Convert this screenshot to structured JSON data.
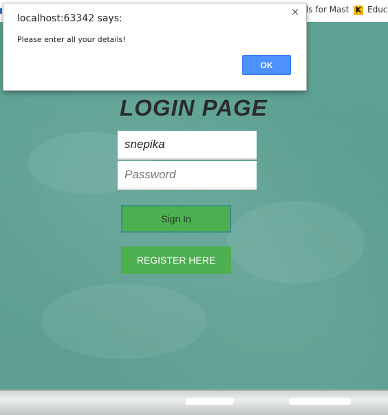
{
  "bookmarks": {
    "item_1": "ls for Mast",
    "item_2": "Educ",
    "item_2_icon": "K"
  },
  "dialog": {
    "title": "localhost:63342 says:",
    "message": "Please enter all your details!",
    "ok_label": "OK",
    "close_glyph": "×"
  },
  "login": {
    "title": "LOGIN PAGE",
    "username_value": "snepika",
    "password_placeholder": "Password",
    "signin_label": "Sign In",
    "register_label": "REGISTER HERE"
  },
  "colors": {
    "chalkboard": "#5f9f92",
    "button_green": "#4caf50",
    "dialog_ok_blue": "#4d90fe"
  }
}
